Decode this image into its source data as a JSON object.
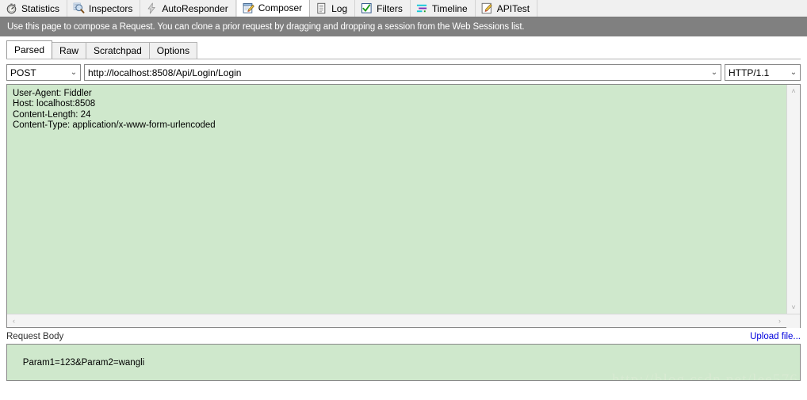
{
  "tabs": [
    {
      "label": "Statistics",
      "icon": "statistics-icon",
      "active": false
    },
    {
      "label": "Inspectors",
      "icon": "inspectors-icon",
      "active": false
    },
    {
      "label": "AutoResponder",
      "icon": "autoresponder-icon",
      "active": false
    },
    {
      "label": "Composer",
      "icon": "composer-icon",
      "active": true
    },
    {
      "label": "Log",
      "icon": "log-icon",
      "active": false
    },
    {
      "label": "Filters",
      "icon": "filters-icon",
      "active": false
    },
    {
      "label": "Timeline",
      "icon": "timeline-icon",
      "active": false
    },
    {
      "label": "APITest",
      "icon": "apitest-icon",
      "active": false
    }
  ],
  "banner": {
    "text": "Use this page to compose a Request. You can clone a prior request by dragging and dropping a session from the Web Sessions list."
  },
  "subtabs": [
    {
      "label": "Parsed",
      "active": true
    },
    {
      "label": "Raw",
      "active": false
    },
    {
      "label": "Scratchpad",
      "active": false
    },
    {
      "label": "Options",
      "active": false
    }
  ],
  "request": {
    "method": "POST",
    "url": "http://localhost:8508/Api/Login/Login",
    "version": "HTTP/1.1",
    "chevron": "⌄",
    "headers": "User-Agent: Fiddler\nHost: localhost:8508\nContent-Length: 24\nContent-Type: application/x-www-form-urlencoded"
  },
  "scrollbars": {
    "up_arrow": "˄",
    "down_arrow": "˅",
    "left_arrow": "‹",
    "right_arrow": "›"
  },
  "body_section": {
    "label": "Request Body",
    "upload_link": "Upload file...",
    "value": "Param1=123&Param2=wangli"
  },
  "watermark": {
    "text": "http://blog.csdn.net/lee576"
  },
  "colors": {
    "editor_green": "#cfe8cc",
    "banner_gray": "#808080",
    "link_blue": "#0000dd"
  }
}
